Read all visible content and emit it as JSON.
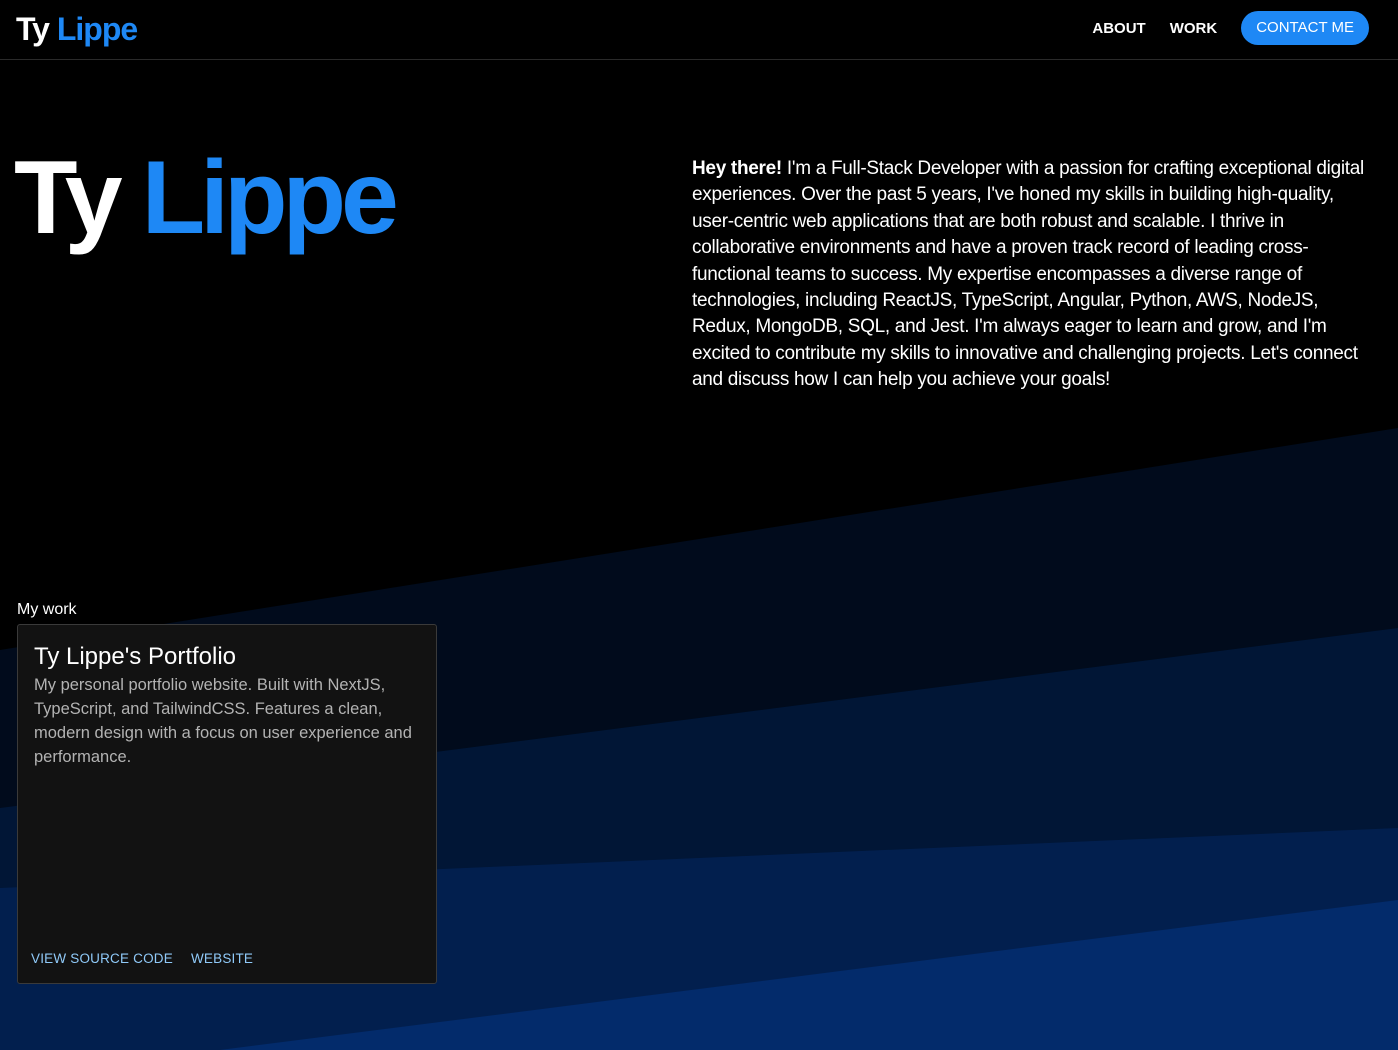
{
  "header": {
    "logo_first": "Ty",
    "logo_last": "Lippe",
    "nav": {
      "about": "ABOUT",
      "work": "WORK",
      "contact": "CONTACT ME"
    }
  },
  "hero": {
    "name_first": "Ty",
    "name_last": "Lippe",
    "intro_bold": "Hey there!",
    "intro_text": " I'm a Full-Stack Developer with a passion for crafting exceptional digital experiences. Over the past 5 years, I've honed my skills in building high-quality, user-centric web applications that are both robust and scalable. I thrive in collaborative environments and have a proven track record of leading cross-functional teams to success. My expertise encompasses a diverse range of technologies, including ReactJS, TypeScript, Angular, Python, AWS, NodeJS, Redux, MongoDB, SQL, and Jest. I'm always eager to learn and grow, and I'm excited to contribute my skills to innovative and challenging projects. Let's connect and discuss how I can help you achieve your goals!"
  },
  "work": {
    "heading": "My work",
    "projects": [
      {
        "title": "Ty Lippe's Portfolio",
        "description": "My personal portfolio website. Built with NextJS, TypeScript, and TailwindCSS. Features a clean, modern design with a focus on user experience and performance.",
        "source_label": "VIEW SOURCE CODE",
        "website_label": "WEBSITE"
      }
    ]
  },
  "colors": {
    "accent": "#1e88f5",
    "background": "#000000",
    "card_bg": "#121212",
    "link": "#90caf9"
  }
}
